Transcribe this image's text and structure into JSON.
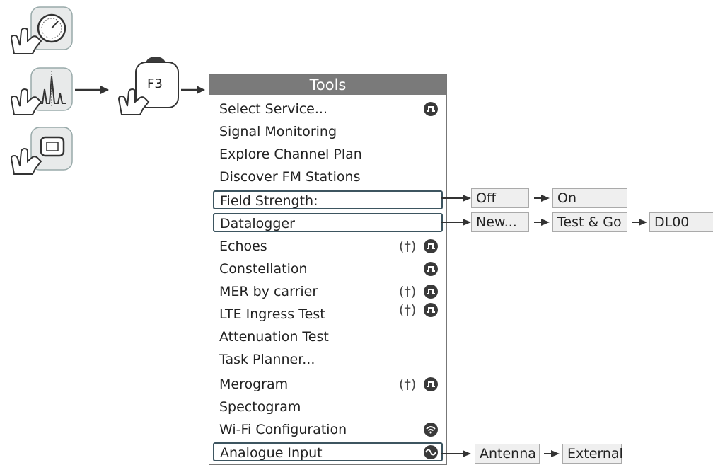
{
  "f3_label": "F3",
  "menu": {
    "title": "Tools",
    "items": [
      {
        "label": "Select Service...",
        "icon": "signal-pulse-icon",
        "antenna": false
      },
      {
        "label": "Signal Monitoring"
      },
      {
        "label": "Explore Channel Plan"
      },
      {
        "label": "Discover FM Stations"
      },
      {
        "label": "Field Strength:",
        "boxed": true
      },
      {
        "label": "Datalogger",
        "boxed": true
      },
      {
        "label": "Echoes",
        "icon": "signal-pulse-icon",
        "antenna": true
      },
      {
        "label": "Constellation",
        "icon": "signal-pulse-icon"
      },
      {
        "label": "MER by carrier",
        "icon": "signal-pulse-icon",
        "antenna": true
      },
      {
        "label": "LTE Ingress Test",
        "icon": "signal-pulse-icon",
        "antenna": true
      },
      {
        "label": "Attenuation Test"
      },
      {
        "label": "Task Planner..."
      },
      {
        "label": "Merogram",
        "icon": "signal-pulse-icon",
        "antenna": true
      },
      {
        "label": "Spectogram"
      },
      {
        "label": "Wi-Fi Configuration",
        "icon": "wifi-icon"
      },
      {
        "label": "Analogue Input",
        "icon": "sine-wave-icon",
        "boxed": true
      }
    ]
  },
  "field_strength": {
    "opt1": "Off",
    "opt2": "On"
  },
  "datalogger": {
    "opt1": "New...",
    "opt2": "Test & Go",
    "opt3": "DL00"
  },
  "analogue_input": {
    "opt1": "Antenna",
    "opt2": "External"
  },
  "antenna_glyph": "(†)"
}
